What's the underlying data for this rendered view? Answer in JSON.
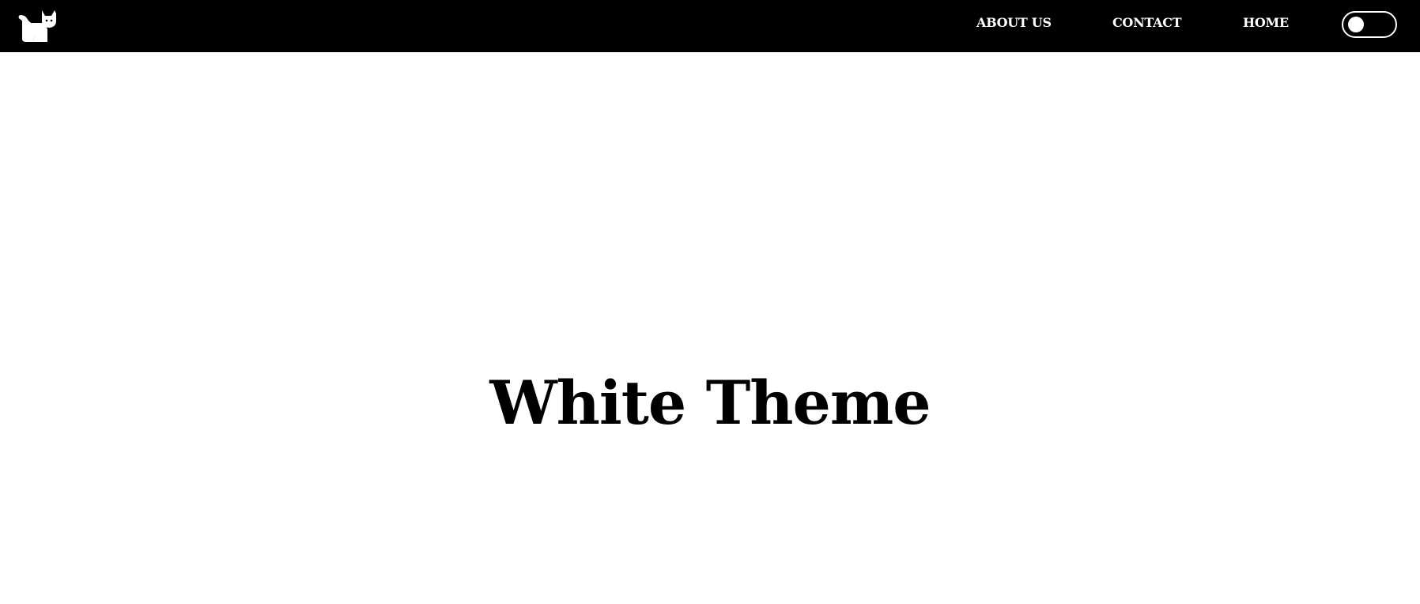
{
  "header": {
    "logo_icon": "cat-icon",
    "nav": {
      "about": "ABOUT US",
      "contact": "CONTACT",
      "home": "HOME"
    },
    "theme_toggle": {
      "state": "off"
    }
  },
  "main": {
    "title": "White Theme"
  },
  "colors": {
    "navbar_bg": "#000000",
    "nav_text": "#ffffff",
    "page_bg": "#ffffff",
    "title_text": "#000000"
  }
}
